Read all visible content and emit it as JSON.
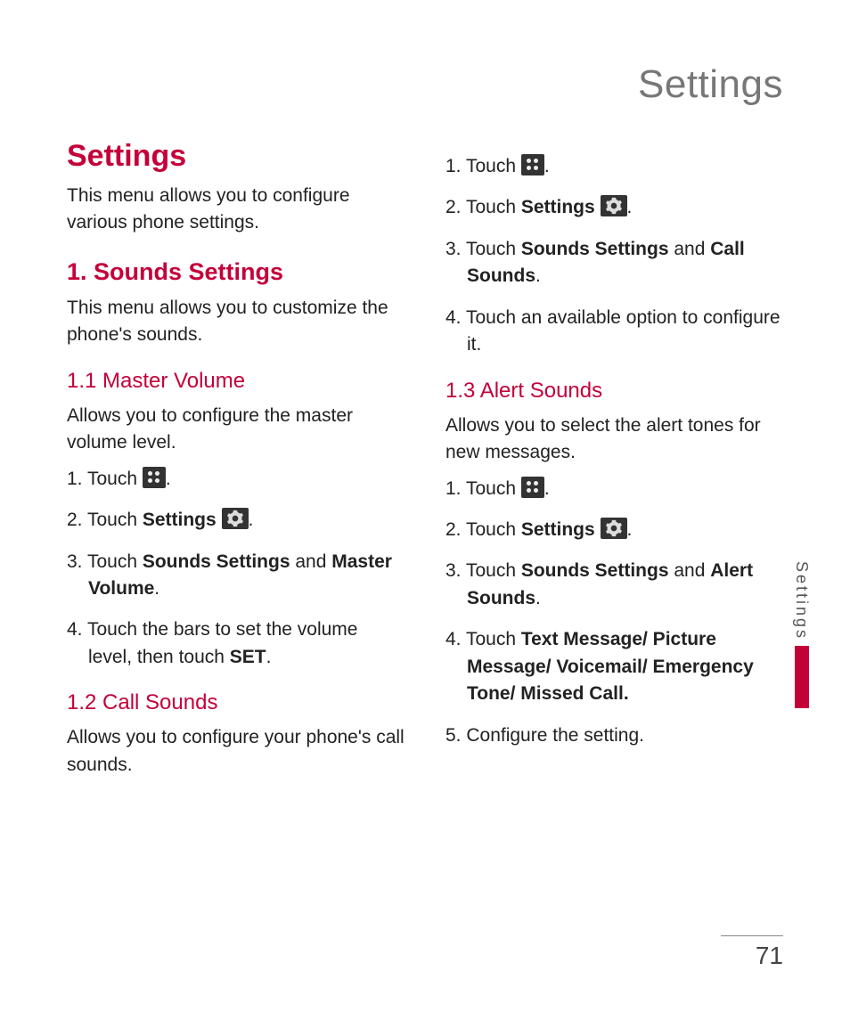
{
  "header": "Settings",
  "pageNumber": "71",
  "sideTab": "Settings",
  "col1": {
    "h1": "Settings",
    "intro": "This menu allows you to configure various phone settings.",
    "sec1": {
      "title": "1. Sounds Settings",
      "intro": "This menu allows you to customize the phone's sounds.",
      "s11": {
        "title": "1.1 Master Volume",
        "intro": "Allows you to configure the master volume level.",
        "step1a": "1. Touch ",
        "step1b": ".",
        "step2a": "2. Touch ",
        "step2b": "Settings",
        "step2c": " ",
        "step2d": ".",
        "step3a": "3. Touch ",
        "step3b": "Sounds Settings",
        "step3c": " and ",
        "step3d": "Master Volume",
        "step3e": ".",
        "step4a": "4. Touch the bars to set the volume level, then touch ",
        "step4b": "SET",
        "step4c": "."
      },
      "s12": {
        "title": "1.2 Call Sounds",
        "intro": "Allows you to configure your phone's call sounds."
      }
    }
  },
  "col2": {
    "s12steps": {
      "step1a": "1. Touch ",
      "step1b": ".",
      "step2a": "2. Touch ",
      "step2b": "Settings",
      "step2c": " ",
      "step2d": ".",
      "step3a": "3. Touch ",
      "step3b": "Sounds Settings",
      "step3c": " and ",
      "step3d": "Call Sounds",
      "step3e": ".",
      "step4": "4. Touch an available option to configure it."
    },
    "s13": {
      "title": "1.3 Alert Sounds",
      "intro": "Allows you to select the alert tones for new messages.",
      "step1a": "1. Touch ",
      "step1b": ".",
      "step2a": "2. Touch ",
      "step2b": "Settings",
      "step2c": " ",
      "step2d": ".",
      "step3a": "3. Touch ",
      "step3b": "Sounds Settings",
      "step3c": " and ",
      "step3d": "Alert Sounds",
      "step3e": ".",
      "step4a": "4. Touch ",
      "step4b": "Text Message/ Picture Message/ Voicemail/ Emergency Tone/ Missed Call.",
      "step5": "5. Configure the setting."
    }
  }
}
